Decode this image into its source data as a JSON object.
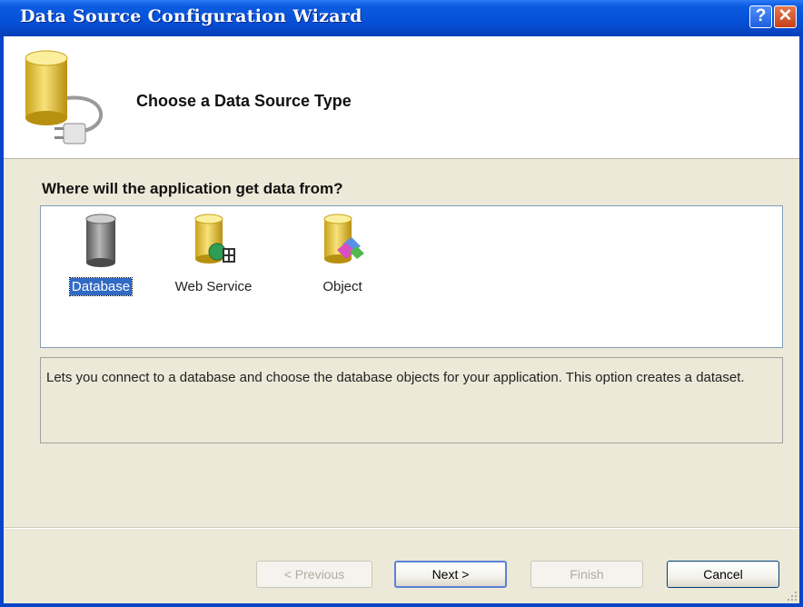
{
  "window": {
    "title": "Data Source Configuration Wizard",
    "help_glyph": "?",
    "close_glyph": "✕"
  },
  "header": {
    "title": "Choose a Data Source Type",
    "icon": "database-plug-icon"
  },
  "question": "Where will the application get data from?",
  "source_types": [
    {
      "label": "Database",
      "icon": "database-icon",
      "selected": true
    },
    {
      "label": "Web Service",
      "icon": "web-service-icon",
      "selected": false
    },
    {
      "label": "Object",
      "icon": "object-icon",
      "selected": false
    }
  ],
  "description": "Lets you connect to a database and choose the database objects for your application. This option creates a dataset.",
  "buttons": {
    "previous": "< Previous",
    "next": "Next >",
    "finish": "Finish",
    "cancel": "Cancel"
  },
  "colors": {
    "title_bar": "#0550d8",
    "selection": "#316ac5",
    "dialog_bg": "#ece9d8"
  }
}
